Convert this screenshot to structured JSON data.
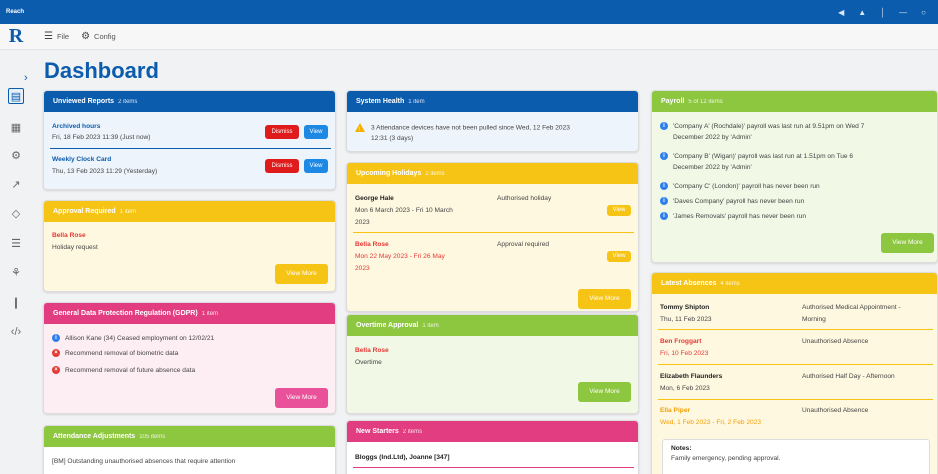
{
  "app": {
    "name": "Reach",
    "logo_letter": "R"
  },
  "window_controls": [
    "◀",
    "▲",
    "│",
    "—",
    "○"
  ],
  "menu": {
    "file": "File",
    "config": "Config"
  },
  "page_title": "Dashboard",
  "rail": {
    "expand": "›",
    "items": [
      "▤",
      "▦",
      "⚙",
      "↗",
      "◇",
      "☰",
      "⚘",
      "❙",
      "‹/›"
    ]
  },
  "unviewed_reports": {
    "title": "Unviewed Reports",
    "count": "2 items",
    "items": [
      {
        "name": "Archived hours",
        "date": "Fri, 18 Feb 2023 11:39 (Just now)",
        "dismiss": "Dismiss",
        "view": "View"
      },
      {
        "name": "Weekly Clock Card",
        "date": "Thu, 13 Feb 2023 11:29 (Yesterday)",
        "dismiss": "Dismiss",
        "view": "View"
      }
    ]
  },
  "approval_required": {
    "title": "Approval Required",
    "count": "1 item",
    "name": "Bella Rose",
    "desc": "Holiday request",
    "more": "View More"
  },
  "gdpr": {
    "title": "General Data Protection Regulation (GDPR)",
    "count": "1 item",
    "lines": [
      {
        "icon": "info",
        "text": "Allison Kane (34) Ceased employment on 12/02/21"
      },
      {
        "icon": "x",
        "text": "Recommend removal of biometric data"
      },
      {
        "icon": "x",
        "text": "Recommend removal of future absence data"
      }
    ],
    "more": "View More"
  },
  "attendance_adjustments": {
    "title": "Attendance Adjustments",
    "count": "105 items",
    "line": "[BM] Outstanding unauthorised absences that require attention"
  },
  "system_health": {
    "title": "System Health",
    "count": "1 item",
    "line1": "3 Attendance devices have not been pulled since Wed, 12 Feb 2023",
    "line2": "12:31 (3 days)"
  },
  "upcoming_holidays": {
    "title": "Upcoming Holidays",
    "count": "2 items",
    "items": [
      {
        "name": "George Hale",
        "dates1": "Mon 6 March 2023 - Fri 10 March",
        "dates2": "2023",
        "status": "Authorised holiday",
        "view": "View"
      },
      {
        "name": "Bella Rose",
        "dates1": "Mon 22 May 2023 - Fri 26 May",
        "dates2": "2023",
        "status": "Approval required",
        "view": "View"
      }
    ],
    "more": "View More"
  },
  "overtime_approval": {
    "title": "Overtime Approval",
    "count": "1 item",
    "name": "Bella Rose",
    "desc": "Overtime",
    "more": "View More"
  },
  "new_starters": {
    "title": "New Starters",
    "count": "2 items",
    "line": "Bloggs (Ind.Ltd), Joanne [347]"
  },
  "payroll": {
    "title": "Payroll",
    "count": "5 of 12 items",
    "lines": [
      [
        "'Company A' (Rochdale)' payroll was last run at 9.51pm on Wed 7",
        "December 2022 by 'Admin'"
      ],
      [
        "'Company B' (Wigan)' payroll was last run at 1.51pm on Tue 6",
        "December 2022 by 'Admin'"
      ],
      [
        "'Company C' (London)' payroll has never been run"
      ],
      [
        "'Daves Company' payroll has never been run"
      ],
      [
        "'James Removals' payroll has never been run"
      ]
    ],
    "more": "View More"
  },
  "latest_absences": {
    "title": "Latest Absences",
    "count": "4 items",
    "items": [
      {
        "name": "Tommy Shipton",
        "date": "Thu, 11 Feb 2023",
        "type1": "Authorised Medical Appointment -",
        "type2": "Morning",
        "style": "dark"
      },
      {
        "name": "Ben Froggart",
        "date": "Fri, 10 Feb 2023",
        "type1": "Unauthorised Absence",
        "type2": "",
        "style": "red"
      },
      {
        "name": "Elizabeth Flaunders",
        "date": "Mon, 6 Feb 2023",
        "type1": "Authorised Half Day - Afternoon",
        "type2": "",
        "style": "dark"
      },
      {
        "name": "Ella Piper",
        "date": "Wed, 1 Feb 2023 - Fri, 2 Feb 2023",
        "type1": "Unauthorised Absence",
        "type2": "",
        "style": "orange"
      }
    ],
    "notes_label": "Notes:",
    "notes_text": "Family emergency, pending approval."
  }
}
